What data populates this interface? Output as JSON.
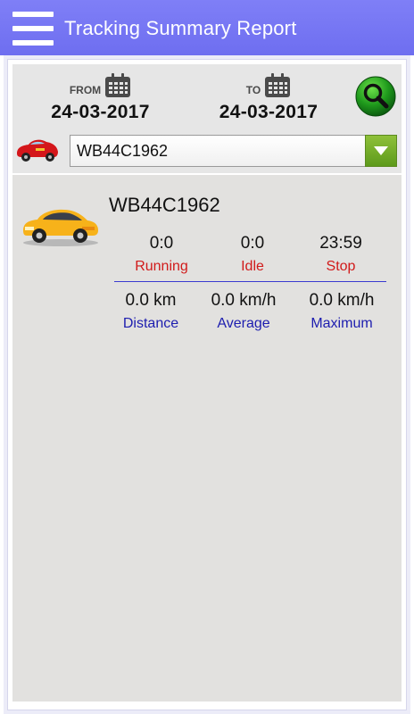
{
  "appbar": {
    "title": "Tracking Summary Report",
    "menu_icon": "hamburger-menu-icon",
    "background": "#7676f3"
  },
  "filter": {
    "from_label": "FROM",
    "from_date": "24-03-2017",
    "to_label": "TO",
    "to_date": "24-03-2017",
    "calendar_icon": "calendar-icon",
    "search_icon": "magnifier-search-icon",
    "vehicle_icon": "red-car-icon",
    "selected_vehicle": "WB44C1962",
    "dropdown_icon": "dropdown-arrow-icon",
    "accent": "#6aa82a"
  },
  "summary": {
    "vehicle_image": "yellow-taxi-icon",
    "vehicle_name": "WB44C1962",
    "running_value": "0:0",
    "running_label": "Running",
    "idle_value": "0:0",
    "idle_label": "Idle",
    "stop_value": "23:59",
    "stop_label": "Stop",
    "distance_value": "0.0 km",
    "distance_label": "Distance",
    "average_value": "0.0 km/h",
    "average_label": "Average",
    "maximum_value": "0.0 km/h",
    "maximum_label": "Maximum",
    "status_color": "#d11a1a",
    "metric_color": "#1d1daf"
  }
}
